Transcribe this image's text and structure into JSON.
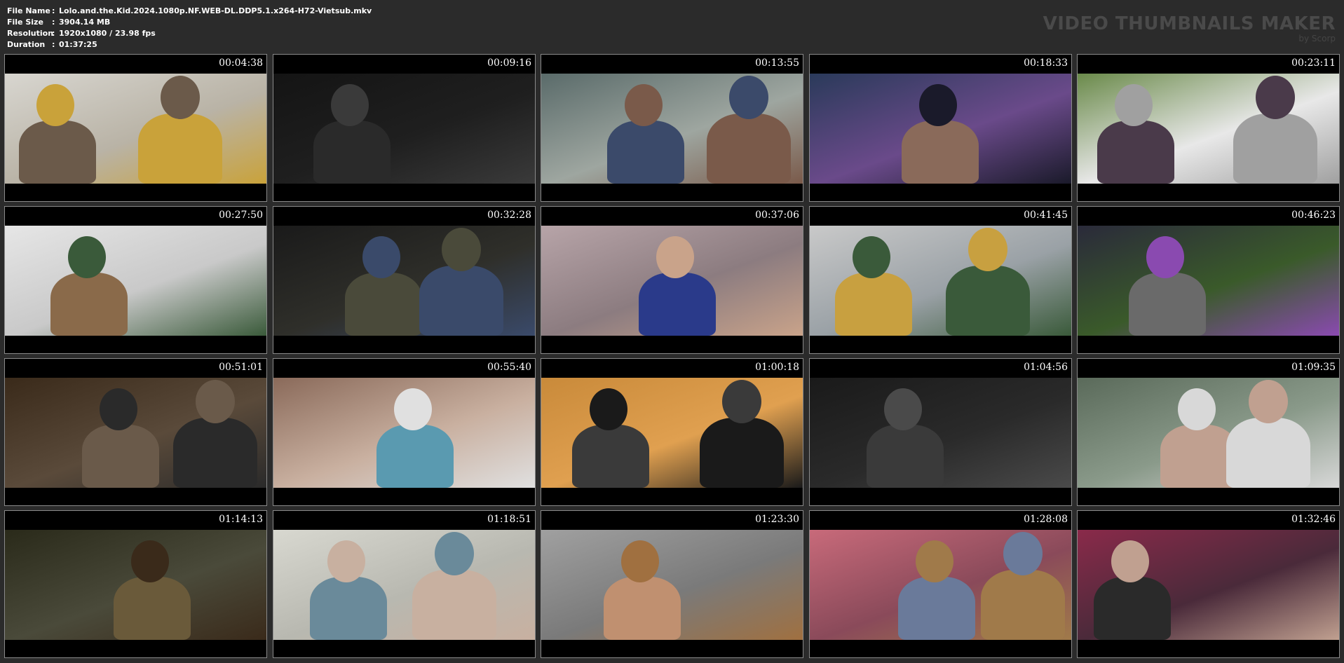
{
  "info": {
    "rows": [
      {
        "key": "File Name",
        "value": "Lolo.and.the.Kid.2024.1080p.NF.WEB-DL.DDP5.1.x264-H72-Vietsub.mkv"
      },
      {
        "key": "File Size",
        "value": "3904.14 MB"
      },
      {
        "key": "Resolution",
        "value": "1920x1080 / 23.98 fps"
      },
      {
        "key": "Duration",
        "value": "01:37:25"
      }
    ]
  },
  "brand": {
    "title": "VIDEO THUMBNAILS MAKER",
    "subtitle": "by Scorp"
  },
  "thumbnails": [
    {
      "time": "00:04:38",
      "scene": "office-conversation",
      "colors": [
        "#d8d6d0",
        "#b9b3a6",
        "#6b5a4a",
        "#c9a23a"
      ]
    },
    {
      "time": "00:09:16",
      "scene": "dark-doorway",
      "colors": [
        "#141414",
        "#1f1f1f",
        "#2a2a2a",
        "#3a3a3a"
      ]
    },
    {
      "time": "00:13:55",
      "scene": "street-walk",
      "colors": [
        "#5a6b6a",
        "#9ea6a0",
        "#3b4a6a",
        "#7a5a4a"
      ]
    },
    {
      "time": "00:18:33",
      "scene": "karaoke",
      "colors": [
        "#2a3a5a",
        "#6a4a8a",
        "#8a6a5a",
        "#1a1a2a"
      ]
    },
    {
      "time": "00:23:11",
      "scene": "garden-gate",
      "colors": [
        "#6a8a4a",
        "#e8e8e8",
        "#4a3a4a",
        "#a0a0a0"
      ]
    },
    {
      "time": "00:27:50",
      "scene": "white-sofa",
      "colors": [
        "#e6e6e6",
        "#c9c9c9",
        "#8a6a4a",
        "#3a5a3a"
      ]
    },
    {
      "time": "00:32:28",
      "scene": "night-alley",
      "colors": [
        "#1a1a1a",
        "#2f2f2a",
        "#4a4a3a",
        "#3a4a6a"
      ]
    },
    {
      "time": "00:37:06",
      "scene": "kitchen-talk",
      "colors": [
        "#b7a4a8",
        "#8c7c80",
        "#2a3a8a",
        "#c9a38a"
      ]
    },
    {
      "time": "00:41:45",
      "scene": "riverside",
      "colors": [
        "#c9c9c9",
        "#9aa1a6",
        "#c8a040",
        "#3a5a3a"
      ]
    },
    {
      "time": "00:46:23",
      "scene": "night-tree",
      "colors": [
        "#2a2a3a",
        "#3a5a2a",
        "#6a6a6a",
        "#8a4ab0"
      ]
    },
    {
      "time": "00:51:01",
      "scene": "dark-room",
      "colors": [
        "#3a2a1a",
        "#5a4a3a",
        "#6a5a4a",
        "#2a2a2a"
      ]
    },
    {
      "time": "00:55:40",
      "scene": "hotel-bed",
      "colors": [
        "#8a6a5a",
        "#c9b0a0",
        "#5a9ab0",
        "#e0e0e0"
      ]
    },
    {
      "time": "01:00:18",
      "scene": "sunset-beach",
      "colors": [
        "#c98a3a",
        "#e0a050",
        "#3a3a3a",
        "#1a1a1a"
      ]
    },
    {
      "time": "01:04:56",
      "scene": "dark-interior",
      "colors": [
        "#1a1a1a",
        "#2a2a2a",
        "#3a3a3a",
        "#4a4a4a"
      ]
    },
    {
      "time": "01:09:35",
      "scene": "couple",
      "colors": [
        "#5a6a5a",
        "#8a9a8a",
        "#c0a090",
        "#d8d8d8"
      ]
    },
    {
      "time": "01:14:13",
      "scene": "iron-gate",
      "colors": [
        "#2a2a1a",
        "#4a4a3a",
        "#6a5a3a",
        "#3a2a1a"
      ]
    },
    {
      "time": "01:18:51",
      "scene": "white-arch",
      "colors": [
        "#d8d8d0",
        "#b8b8b0",
        "#6a8a9a",
        "#c8b0a0"
      ]
    },
    {
      "time": "01:23:30",
      "scene": "close-up",
      "colors": [
        "#a0a0a0",
        "#7a7a7a",
        "#c09070",
        "#a07040"
      ]
    },
    {
      "time": "01:28:08",
      "scene": "cinema-seats",
      "colors": [
        "#c86a7a",
        "#8a4a5a",
        "#6a7a9a",
        "#a07a4a"
      ]
    },
    {
      "time": "01:32:46",
      "scene": "crowd-camera",
      "colors": [
        "#8a2a4a",
        "#4a2a3a",
        "#2a2a2a",
        "#c0a090"
      ]
    }
  ]
}
